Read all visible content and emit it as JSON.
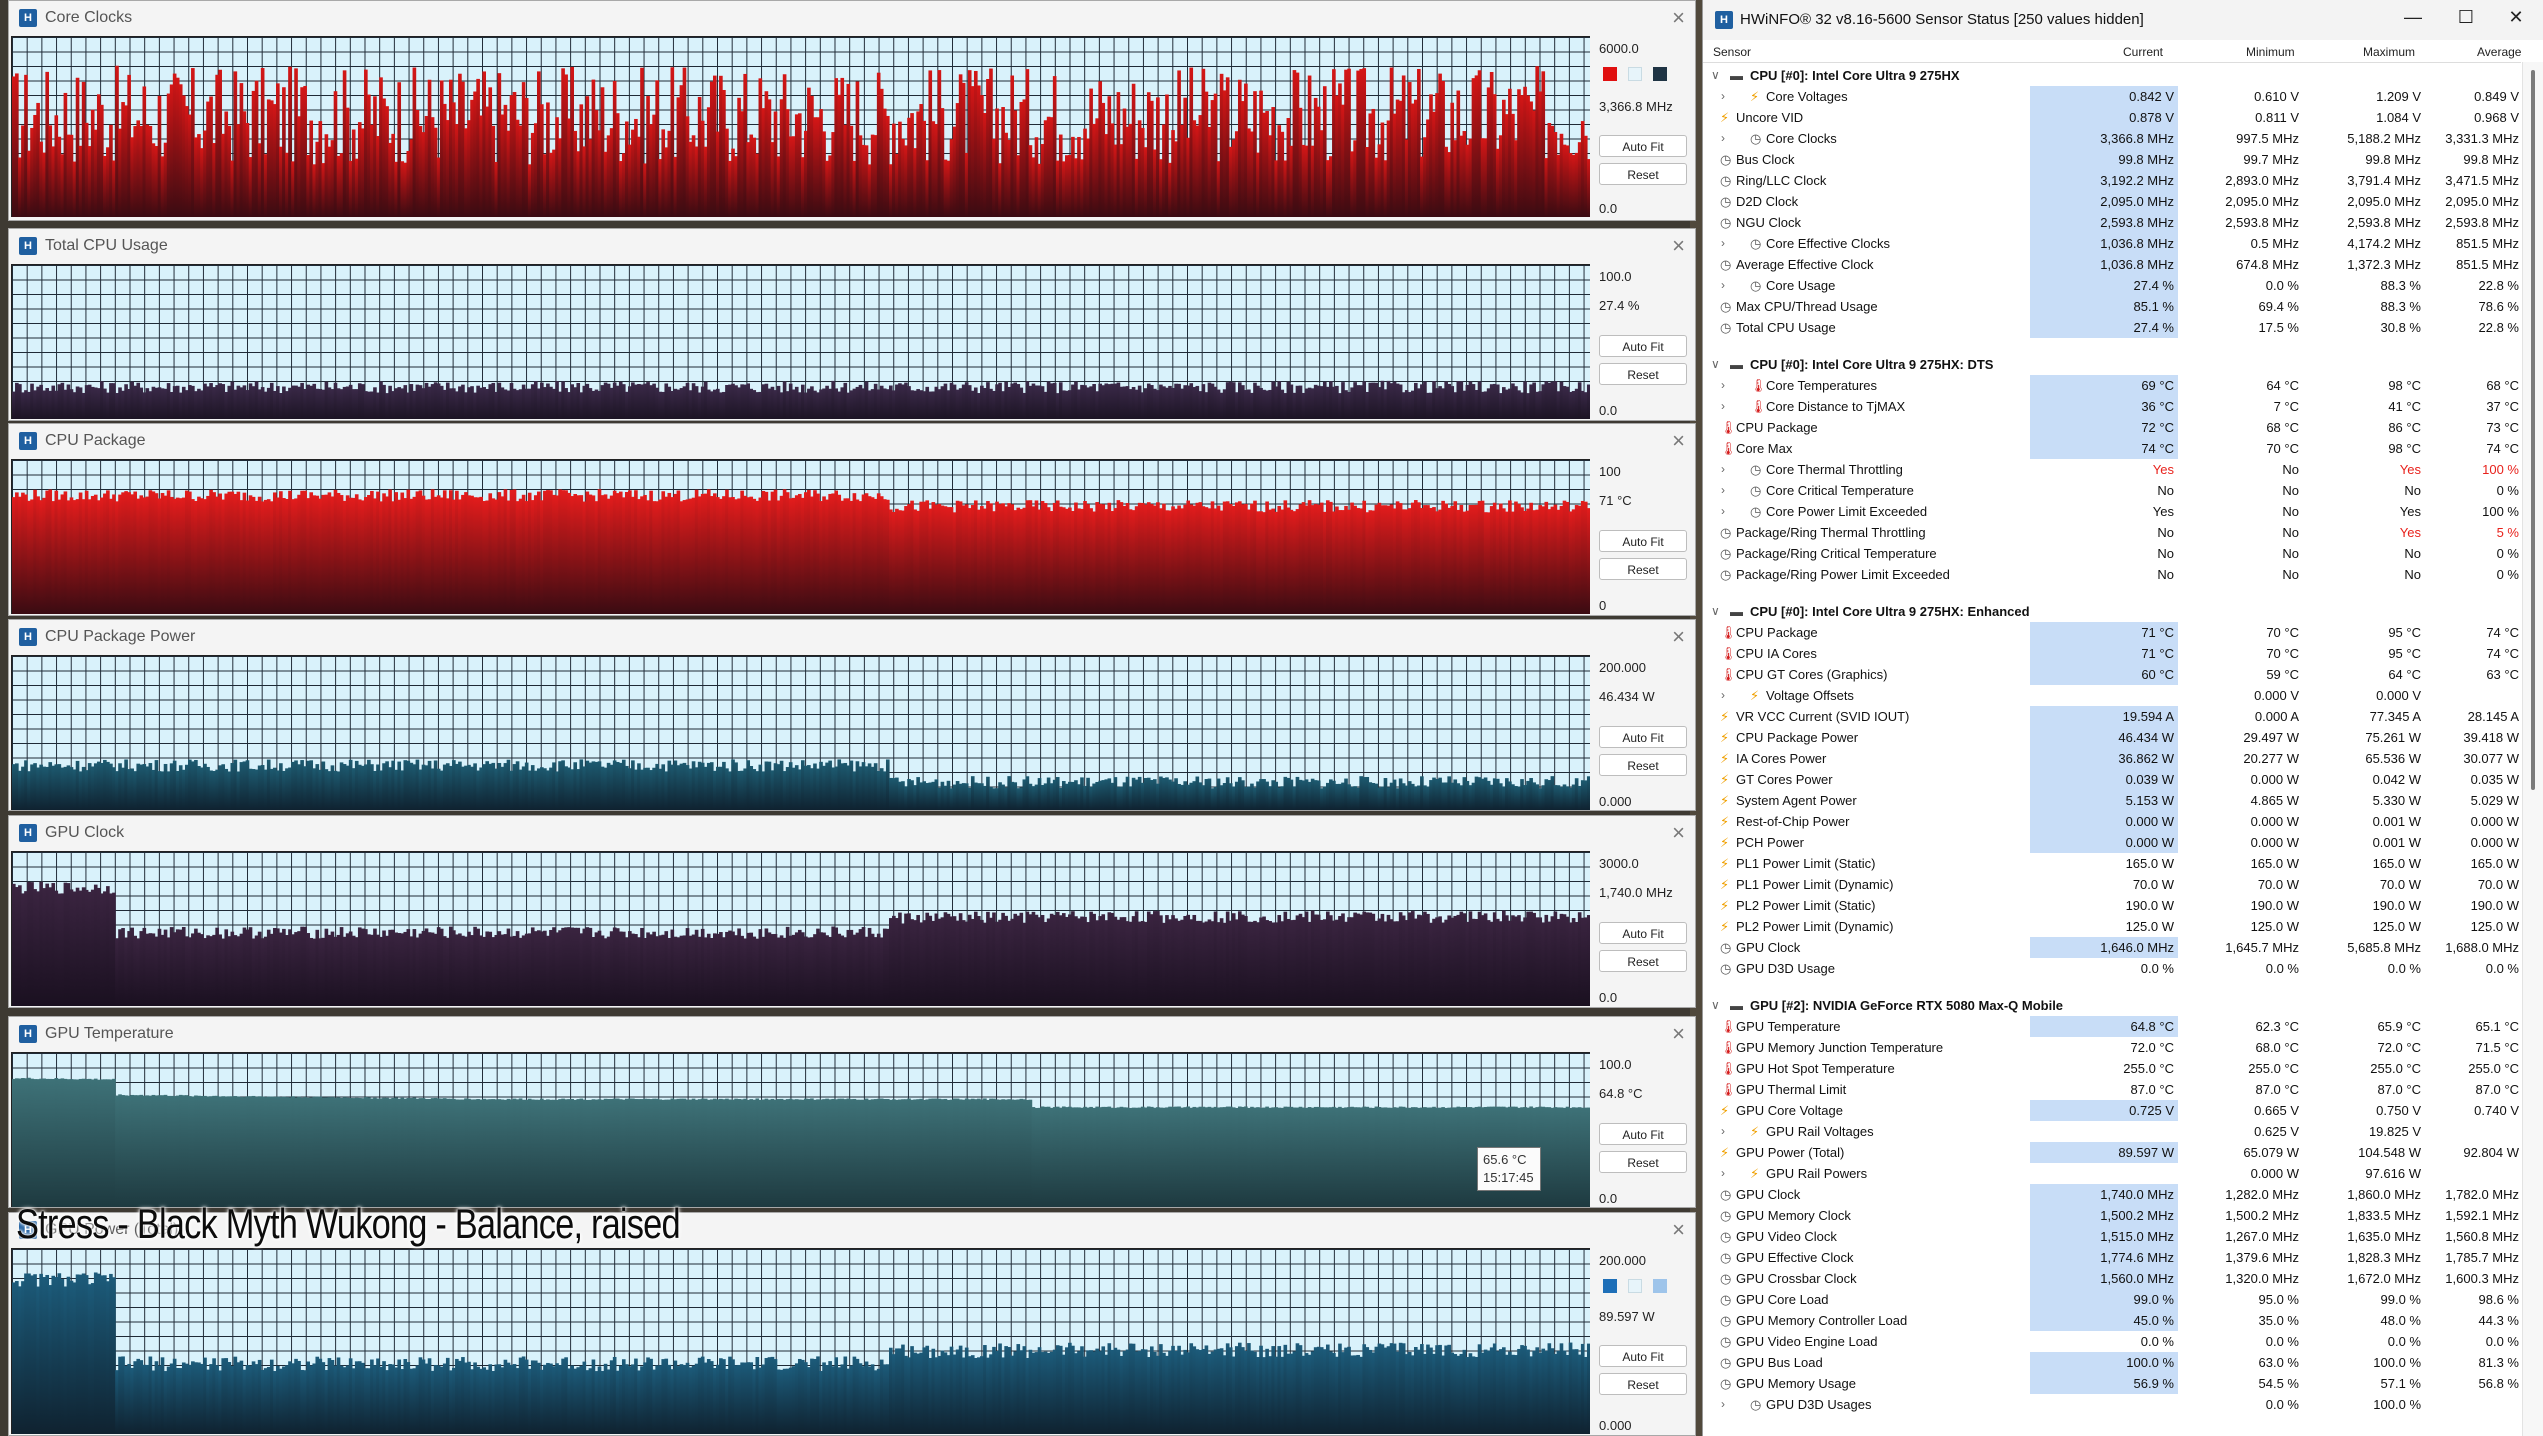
{
  "overlay_caption": "Stress - Black Myth Wukong - Balance, raised",
  "graph_common": {
    "auto_fit_label": "Auto Fit",
    "reset_label": "Reset",
    "close_glyph": "×"
  },
  "graphs": [
    {
      "title": "Core Clocks",
      "max": "6000.0",
      "current": "3,366.8 MHz",
      "min": "0.0",
      "colors": {
        "bar": "#d51616",
        "bar_bottom": "#3a0b12"
      },
      "swatches": [
        "#e01010",
        "#e7f4fa",
        "#1f3444"
      ],
      "chart_data": {
        "type": "bar",
        "ylim": [
          0,
          6000
        ],
        "pattern": "volatile",
        "levels": [
          {
            "from": 0,
            "to": 1,
            "value": 3400
          }
        ]
      }
    },
    {
      "title": "Total CPU Usage",
      "max": "100.0",
      "current": "27.4 %",
      "min": "0.0",
      "colors": {
        "bar": "#3a2948",
        "bar_bottom": "#1c1424"
      },
      "chart_data": {
        "type": "bar",
        "ylim": [
          0,
          100
        ],
        "pattern": "flat",
        "levels": [
          {
            "from": 0,
            "to": 1,
            "value": 20
          }
        ]
      }
    },
    {
      "title": "CPU Package",
      "max": "100",
      "current": "71 °C",
      "min": "0",
      "colors": {
        "bar": "#e31c1c",
        "bar_bottom": "#3a0b12"
      },
      "chart_data": {
        "type": "bar",
        "ylim": [
          0,
          100
        ],
        "pattern": "step",
        "levels": [
          {
            "from": 0,
            "to": 0.555,
            "value": 77
          },
          {
            "from": 0.555,
            "to": 1,
            "value": 70
          }
        ]
      }
    },
    {
      "title": "CPU Package Power",
      "max": "200.000",
      "current": "46.434 W",
      "min": "0.000",
      "colors": {
        "bar": "#1d5a70",
        "bar_bottom": "#0f2230"
      },
      "chart_data": {
        "type": "bar",
        "ylim": [
          0,
          200
        ],
        "pattern": "step",
        "levels": [
          {
            "from": 0,
            "to": 0.555,
            "value": 58
          },
          {
            "from": 0.555,
            "to": 1,
            "value": 36
          }
        ]
      }
    },
    {
      "title": "GPU Clock",
      "max": "3000.0",
      "current": "1,740.0 MHz",
      "min": "0.0",
      "colors": {
        "bar": "#3a2440",
        "bar_bottom": "#1a1020"
      },
      "chart_data": {
        "type": "bar",
        "ylim": [
          0,
          3000
        ],
        "pattern": "step",
        "levels": [
          {
            "from": 0,
            "to": 0.064,
            "value": 2300
          },
          {
            "from": 0.064,
            "to": 0.555,
            "value": 1430
          },
          {
            "from": 0.555,
            "to": 0.645,
            "value": 1720
          },
          {
            "from": 0.645,
            "to": 1,
            "value": 1740
          }
        ]
      }
    },
    {
      "title": "GPU Temperature",
      "max": "100.0",
      "current": "64.8 °C",
      "min": "0.0",
      "colors": {
        "bar": "#3e7278",
        "bar_bottom": "#1e3a40"
      },
      "chart_data": {
        "type": "bar",
        "ylim": [
          0,
          100
        ],
        "pattern": "smooth",
        "levels": [
          {
            "from": 0,
            "to": 0.064,
            "value": 80
          },
          {
            "from": 0.064,
            "to": 0.645,
            "value": 70
          },
          {
            "from": 0.645,
            "to": 1,
            "value": 64.8
          }
        ]
      },
      "tooltip": {
        "line1": "65.6 °C",
        "line2": "15:17:45"
      }
    },
    {
      "title": "GPU Power (Total)",
      "max": "200.000",
      "current": "89.597 W",
      "min": "0.000",
      "colors": {
        "bar": "#1c5b7a",
        "bar_bottom": "#0f2230"
      },
      "swatches": [
        "#1e6fb8",
        "#e7f4fa",
        "#9ec4ea"
      ],
      "chart_data": {
        "type": "bar",
        "ylim": [
          0,
          200
        ],
        "pattern": "step",
        "levels": [
          {
            "from": 0,
            "to": 0.064,
            "value": 167
          },
          {
            "from": 0.064,
            "to": 0.555,
            "value": 76
          },
          {
            "from": 0.555,
            "to": 0.645,
            "value": 90
          },
          {
            "from": 0.645,
            "to": 1,
            "value": 91
          }
        ]
      }
    }
  ],
  "hwinfo": {
    "title": "HWiNFO® 32 v8.16-5600 Sensor Status [250 values hidden]",
    "controls": {
      "minimize": "—",
      "maximize": "☐",
      "close": "✕"
    },
    "columns": {
      "sensor": "Sensor",
      "current": "Current",
      "minimum": "Minimum",
      "maximum": "Maximum",
      "average": "Average"
    },
    "rows": [
      {
        "t": "group",
        "name": "CPU [#0]: Intel Core Ultra 9 275HX"
      },
      {
        "t": "row",
        "exp": true,
        "icon": "bolt",
        "name": "Core Voltages",
        "cur": "0.842 V",
        "min": "0.610 V",
        "max": "1.209 V",
        "avg": "0.849 V"
      },
      {
        "t": "row",
        "icon": "bolt",
        "name": "Uncore VID",
        "cur": "0.878 V",
        "min": "0.811 V",
        "max": "1.084 V",
        "avg": "0.968 V"
      },
      {
        "t": "row",
        "exp": true,
        "icon": "clock",
        "name": "Core Clocks",
        "cur": "3,366.8 MHz",
        "min": "997.5 MHz",
        "max": "5,188.2 MHz",
        "avg": "3,331.3 MHz"
      },
      {
        "t": "row",
        "icon": "clock",
        "name": "Bus Clock",
        "cur": "99.8 MHz",
        "min": "99.7 MHz",
        "max": "99.8 MHz",
        "avg": "99.8 MHz"
      },
      {
        "t": "row",
        "icon": "clock",
        "name": "Ring/LLC Clock",
        "cur": "3,192.2 MHz",
        "min": "2,893.0 MHz",
        "max": "3,791.4 MHz",
        "avg": "3,471.5 MHz"
      },
      {
        "t": "row",
        "icon": "clock",
        "name": "D2D Clock",
        "cur": "2,095.0 MHz",
        "min": "2,095.0 MHz",
        "max": "2,095.0 MHz",
        "avg": "2,095.0 MHz"
      },
      {
        "t": "row",
        "icon": "clock",
        "name": "NGU Clock",
        "cur": "2,593.8 MHz",
        "min": "2,593.8 MHz",
        "max": "2,593.8 MHz",
        "avg": "2,593.8 MHz"
      },
      {
        "t": "row",
        "exp": true,
        "icon": "clock",
        "name": "Core Effective Clocks",
        "cur": "1,036.8 MHz",
        "min": "0.5 MHz",
        "max": "4,174.2 MHz",
        "avg": "851.5 MHz"
      },
      {
        "t": "row",
        "icon": "clock",
        "name": "Average Effective Clock",
        "cur": "1,036.8 MHz",
        "min": "674.8 MHz",
        "max": "1,372.3 MHz",
        "avg": "851.5 MHz"
      },
      {
        "t": "row",
        "exp": true,
        "icon": "clock",
        "name": "Core Usage",
        "cur": "27.4 %",
        "min": "0.0 %",
        "max": "88.3 %",
        "avg": "22.8 %"
      },
      {
        "t": "row",
        "icon": "clock",
        "name": "Max CPU/Thread Usage",
        "cur": "85.1 %",
        "min": "69.4 %",
        "max": "88.3 %",
        "avg": "78.6 %"
      },
      {
        "t": "row",
        "icon": "clock",
        "name": "Total CPU Usage",
        "cur": "27.4 %",
        "min": "17.5 %",
        "max": "30.8 %",
        "avg": "22.8 %"
      },
      {
        "t": "spacer"
      },
      {
        "t": "group",
        "name": "CPU [#0]: Intel Core Ultra 9 275HX: DTS"
      },
      {
        "t": "row",
        "exp": true,
        "icon": "therm",
        "name": "Core Temperatures",
        "cur": "69 °C",
        "min": "64 °C",
        "max": "98 °C",
        "avg": "68 °C"
      },
      {
        "t": "row",
        "exp": true,
        "icon": "therm",
        "name": "Core Distance to TjMAX",
        "cur": "36 °C",
        "min": "7 °C",
        "max": "41 °C",
        "avg": "37 °C"
      },
      {
        "t": "row",
        "icon": "therm",
        "name": "CPU Package",
        "cur": "72 °C",
        "min": "68 °C",
        "max": "86 °C",
        "avg": "73 °C"
      },
      {
        "t": "row",
        "icon": "therm",
        "name": "Core Max",
        "cur": "74 °C",
        "min": "70 °C",
        "max": "98 °C",
        "avg": "74 °C"
      },
      {
        "t": "row",
        "exp": true,
        "icon": "clock",
        "name": "Core Thermal Throttling",
        "cur": "Yes",
        "min": "No",
        "max": "Yes",
        "avg": "100 %",
        "red": [
          "cur",
          "max",
          "avg"
        ],
        "plain": true
      },
      {
        "t": "row",
        "exp": true,
        "icon": "clock",
        "name": "Core Critical Temperature",
        "cur": "No",
        "min": "No",
        "max": "No",
        "avg": "0 %",
        "plain": true
      },
      {
        "t": "row",
        "exp": true,
        "icon": "clock",
        "name": "Core Power Limit Exceeded",
        "cur": "Yes",
        "min": "No",
        "max": "Yes",
        "avg": "100 %",
        "plain": true
      },
      {
        "t": "row",
        "icon": "clock",
        "name": "Package/Ring Thermal Throttling",
        "cur": "No",
        "min": "No",
        "max": "Yes",
        "avg": "5 %",
        "red": [
          "max",
          "avg"
        ],
        "plain": true
      },
      {
        "t": "row",
        "icon": "clock",
        "name": "Package/Ring Critical Temperature",
        "cur": "No",
        "min": "No",
        "max": "No",
        "avg": "0 %",
        "plain": true
      },
      {
        "t": "row",
        "icon": "clock",
        "name": "Package/Ring Power Limit Exceeded",
        "cur": "No",
        "min": "No",
        "max": "No",
        "avg": "0 %",
        "plain": true
      },
      {
        "t": "spacer"
      },
      {
        "t": "group",
        "name": "CPU [#0]: Intel Core Ultra 9 275HX: Enhanced"
      },
      {
        "t": "row",
        "icon": "therm",
        "name": "CPU Package",
        "cur": "71 °C",
        "min": "70 °C",
        "max": "95 °C",
        "avg": "74 °C"
      },
      {
        "t": "row",
        "icon": "therm",
        "name": "CPU IA Cores",
        "cur": "71 °C",
        "min": "70 °C",
        "max": "95 °C",
        "avg": "74 °C"
      },
      {
        "t": "row",
        "icon": "therm",
        "name": "CPU GT Cores (Graphics)",
        "cur": "60 °C",
        "min": "59 °C",
        "max": "64 °C",
        "avg": "63 °C"
      },
      {
        "t": "row",
        "exp": true,
        "icon": "bolt",
        "name": "Voltage Offsets",
        "cur": "",
        "min": "0.000 V",
        "max": "0.000 V",
        "avg": "",
        "plain": true
      },
      {
        "t": "row",
        "icon": "bolt",
        "name": "VR VCC Current (SVID IOUT)",
        "cur": "19.594 A",
        "min": "0.000 A",
        "max": "77.345 A",
        "avg": "28.145 A"
      },
      {
        "t": "row",
        "icon": "bolt",
        "name": "CPU Package Power",
        "cur": "46.434 W",
        "min": "29.497 W",
        "max": "75.261 W",
        "avg": "39.418 W"
      },
      {
        "t": "row",
        "icon": "bolt",
        "name": "IA Cores Power",
        "cur": "36.862 W",
        "min": "20.277 W",
        "max": "65.536 W",
        "avg": "30.077 W"
      },
      {
        "t": "row",
        "icon": "bolt",
        "name": "GT Cores Power",
        "cur": "0.039 W",
        "min": "0.000 W",
        "max": "0.042 W",
        "avg": "0.035 W"
      },
      {
        "t": "row",
        "icon": "bolt",
        "name": "System Agent Power",
        "cur": "5.153 W",
        "min": "4.865 W",
        "max": "5.330 W",
        "avg": "5.029 W"
      },
      {
        "t": "row",
        "icon": "bolt",
        "name": "Rest-of-Chip Power",
        "cur": "0.000 W",
        "min": "0.000 W",
        "max": "0.001 W",
        "avg": "0.000 W"
      },
      {
        "t": "row",
        "icon": "bolt",
        "name": "PCH Power",
        "cur": "0.000 W",
        "min": "0.000 W",
        "max": "0.001 W",
        "avg": "0.000 W"
      },
      {
        "t": "row",
        "icon": "bolt",
        "name": "PL1 Power Limit (Static)",
        "cur": "165.0 W",
        "min": "165.0 W",
        "max": "165.0 W",
        "avg": "165.0 W",
        "plain": true
      },
      {
        "t": "row",
        "icon": "bolt",
        "name": "PL1 Power Limit (Dynamic)",
        "cur": "70.0 W",
        "min": "70.0 W",
        "max": "70.0 W",
        "avg": "70.0 W",
        "plain": true
      },
      {
        "t": "row",
        "icon": "bolt",
        "name": "PL2 Power Limit (Static)",
        "cur": "190.0 W",
        "min": "190.0 W",
        "max": "190.0 W",
        "avg": "190.0 W",
        "plain": true
      },
      {
        "t": "row",
        "icon": "bolt",
        "name": "PL2 Power Limit (Dynamic)",
        "cur": "125.0 W",
        "min": "125.0 W",
        "max": "125.0 W",
        "avg": "125.0 W",
        "plain": true
      },
      {
        "t": "row",
        "icon": "clock",
        "name": "GPU Clock",
        "cur": "1,646.0 MHz",
        "min": "1,645.7 MHz",
        "max": "5,685.8 MHz",
        "avg": "1,688.0 MHz"
      },
      {
        "t": "row",
        "icon": "clock",
        "name": "GPU D3D Usage",
        "cur": "0.0 %",
        "min": "0.0 %",
        "max": "0.0 %",
        "avg": "0.0 %",
        "plain": true
      },
      {
        "t": "spacer"
      },
      {
        "t": "group",
        "name": "GPU [#2]: NVIDIA  GeForce RTX 5080 Max-Q Mobile"
      },
      {
        "t": "row",
        "icon": "therm",
        "name": "GPU Temperature",
        "cur": "64.8 °C",
        "min": "62.3 °C",
        "max": "65.9 °C",
        "avg": "65.1 °C"
      },
      {
        "t": "row",
        "icon": "therm",
        "name": "GPU Memory Junction Temperature",
        "cur": "72.0 °C",
        "min": "68.0 °C",
        "max": "72.0 °C",
        "avg": "71.5 °C",
        "plain": true
      },
      {
        "t": "row",
        "icon": "therm",
        "name": "GPU Hot Spot Temperature",
        "cur": "255.0 °C",
        "min": "255.0 °C",
        "max": "255.0 °C",
        "avg": "255.0 °C",
        "plain": true
      },
      {
        "t": "row",
        "icon": "therm",
        "name": "GPU Thermal Limit",
        "cur": "87.0 °C",
        "min": "87.0 °C",
        "max": "87.0 °C",
        "avg": "87.0 °C",
        "plain": true
      },
      {
        "t": "row",
        "icon": "bolt",
        "name": "GPU Core Voltage",
        "cur": "0.725 V",
        "min": "0.665 V",
        "max": "0.750 V",
        "avg": "0.740 V"
      },
      {
        "t": "row",
        "exp": true,
        "icon": "bolt",
        "name": "GPU Rail Voltages",
        "cur": "",
        "min": "0.625 V",
        "max": "19.825 V",
        "avg": "",
        "plain": true
      },
      {
        "t": "row",
        "icon": "bolt",
        "name": "GPU Power (Total)",
        "cur": "89.597 W",
        "min": "65.079 W",
        "max": "104.548 W",
        "avg": "92.804 W"
      },
      {
        "t": "row",
        "exp": true,
        "icon": "bolt",
        "name": "GPU Rail Powers",
        "cur": "",
        "min": "0.000 W",
        "max": "97.616 W",
        "avg": "",
        "plain": true
      },
      {
        "t": "row",
        "icon": "clock",
        "name": "GPU Clock",
        "cur": "1,740.0 MHz",
        "min": "1,282.0 MHz",
        "max": "1,860.0 MHz",
        "avg": "1,782.0 MHz"
      },
      {
        "t": "row",
        "icon": "clock",
        "name": "GPU Memory Clock",
        "cur": "1,500.2 MHz",
        "min": "1,500.2 MHz",
        "max": "1,833.5 MHz",
        "avg": "1,592.1 MHz"
      },
      {
        "t": "row",
        "icon": "clock",
        "name": "GPU Video Clock",
        "cur": "1,515.0 MHz",
        "min": "1,267.0 MHz",
        "max": "1,635.0 MHz",
        "avg": "1,560.8 MHz"
      },
      {
        "t": "row",
        "icon": "clock",
        "name": "GPU Effective Clock",
        "cur": "1,774.6 MHz",
        "min": "1,379.6 MHz",
        "max": "1,828.3 MHz",
        "avg": "1,785.7 MHz"
      },
      {
        "t": "row",
        "icon": "clock",
        "name": "GPU Crossbar Clock",
        "cur": "1,560.0 MHz",
        "min": "1,320.0 MHz",
        "max": "1,672.0 MHz",
        "avg": "1,600.3 MHz"
      },
      {
        "t": "row",
        "icon": "clock",
        "name": "GPU Core Load",
        "cur": "99.0 %",
        "min": "95.0 %",
        "max": "99.0 %",
        "avg": "98.6 %"
      },
      {
        "t": "row",
        "icon": "clock",
        "name": "GPU Memory Controller Load",
        "cur": "45.0 %",
        "min": "35.0 %",
        "max": "48.0 %",
        "avg": "44.3 %"
      },
      {
        "t": "row",
        "icon": "clock",
        "name": "GPU Video Engine Load",
        "cur": "0.0 %",
        "min": "0.0 %",
        "max": "0.0 %",
        "avg": "0.0 %",
        "plain": true
      },
      {
        "t": "row",
        "icon": "clock",
        "name": "GPU Bus Load",
        "cur": "100.0 %",
        "min": "63.0 %",
        "max": "100.0 %",
        "avg": "81.3 %"
      },
      {
        "t": "row",
        "icon": "clock",
        "name": "GPU Memory Usage",
        "cur": "56.9 %",
        "min": "54.5 %",
        "max": "57.1 %",
        "avg": "56.8 %"
      },
      {
        "t": "row",
        "exp": true,
        "icon": "clock",
        "name": "GPU D3D Usages",
        "cur": "",
        "min": "0.0 %",
        "max": "100.0 %",
        "avg": "",
        "plain": true
      }
    ]
  }
}
